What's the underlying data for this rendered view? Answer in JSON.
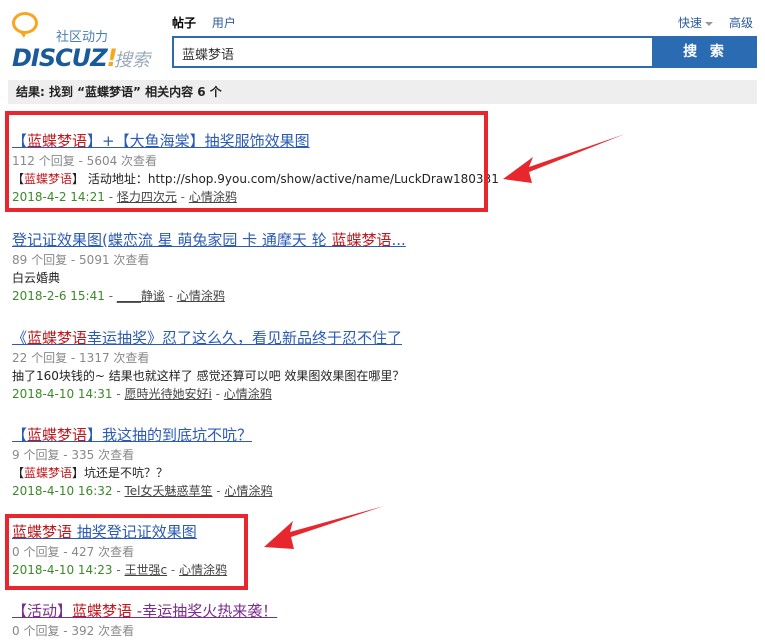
{
  "logo": {
    "tagline": "社区动力",
    "brand_main": "DISCUZ",
    "brand_bang": "!",
    "brand_suffix": "搜索"
  },
  "tabs": [
    {
      "label": "帖子",
      "active": true
    },
    {
      "label": "用户",
      "active": false
    }
  ],
  "top_right": {
    "quick": "快速",
    "advanced": "高级"
  },
  "search": {
    "value": "蓝蝶梦语",
    "button_label": "搜 索"
  },
  "result_summary": "结果: 找到 “蓝蝶梦语” 相关内容 6 个",
  "results": [
    {
      "title_parts": [
        {
          "t": "【",
          "h": false
        },
        {
          "t": "蓝蝶梦语",
          "h": true
        },
        {
          "t": "】+【大鱼海棠】抽奖服饰效果图",
          "h": false
        }
      ],
      "meta": "112 个回复 - 5604 次查看",
      "desc_parts": [
        {
          "t": "【",
          "h": false
        },
        {
          "t": "蓝蝶梦语",
          "h": true
        },
        {
          "t": "】 活动地址：http://shop.9you.com/show/active/name/LuckDraw180331",
          "h": false
        }
      ],
      "date": "2018-4-2 14:21",
      "author": "怪力四次元",
      "forum": "心情涂鸦"
    },
    {
      "title_parts": [
        {
          "t": "登记证效果图(蝶恋流 星 萌兔家园 卡 通摩天 轮 ",
          "h": false
        },
        {
          "t": "蓝蝶梦语",
          "h": true
        },
        {
          "t": "...",
          "h": false
        }
      ],
      "meta": "89 个回复 - 5091 次查看",
      "desc_parts": [
        {
          "t": "白云婚典",
          "h": false
        }
      ],
      "date": "2018-2-6 15:41",
      "author": "____静谧",
      "forum": "心情涂鸦"
    },
    {
      "title_parts": [
        {
          "t": "《",
          "h": false
        },
        {
          "t": "蓝蝶梦语",
          "h": true
        },
        {
          "t": "幸运抽奖》忍了这么久，看见新品终于忍不住了",
          "h": false
        }
      ],
      "meta": "22 个回复 - 1317 次查看",
      "desc_parts": [
        {
          "t": "抽了160块钱的~ 结果也就这样了 感觉还算可以吧 效果图效果图在哪里？",
          "h": false
        }
      ],
      "date": "2018-4-10 14:31",
      "author": "愿時光待她安好i",
      "forum": "心情涂鸦"
    },
    {
      "title_parts": [
        {
          "t": "【",
          "h": false
        },
        {
          "t": "蓝蝶梦语",
          "h": true
        },
        {
          "t": "】我这抽的到底坑不吭？",
          "h": false
        }
      ],
      "meta": "9 个回复 - 335 次查看",
      "desc_parts": [
        {
          "t": "【",
          "h": false
        },
        {
          "t": "蓝蝶梦语",
          "h": true
        },
        {
          "t": "】坑还是不吭？？",
          "h": false
        }
      ],
      "date": "2018-4-10 16:32",
      "author": "Tel女夭魅惑草笙",
      "forum": "心情涂鸦"
    },
    {
      "title_parts": [
        {
          "t": "蓝蝶梦语",
          "h": true
        },
        {
          "t": " 抽奖登记证效果图",
          "h": false
        }
      ],
      "meta": "0 个回复 - 427 次查看",
      "desc_parts": [],
      "date": "2018-4-10 14:23",
      "author": "王世强c",
      "forum": "心情涂鸦"
    },
    {
      "title_parts": [
        {
          "t": "【活动】",
          "h": false
        },
        {
          "t": "蓝蝶梦语",
          "h": true
        },
        {
          "t": " -幸运抽奖火热来袭！",
          "h": false
        }
      ],
      "meta": "0 个回复 - 392 次查看",
      "desc_parts": [],
      "date": "",
      "author": "",
      "forum": "",
      "purple": true
    }
  ],
  "colors": {
    "accent": "#2b6bb2",
    "highlight": "#c0181c",
    "annotation": "#e8262d"
  }
}
